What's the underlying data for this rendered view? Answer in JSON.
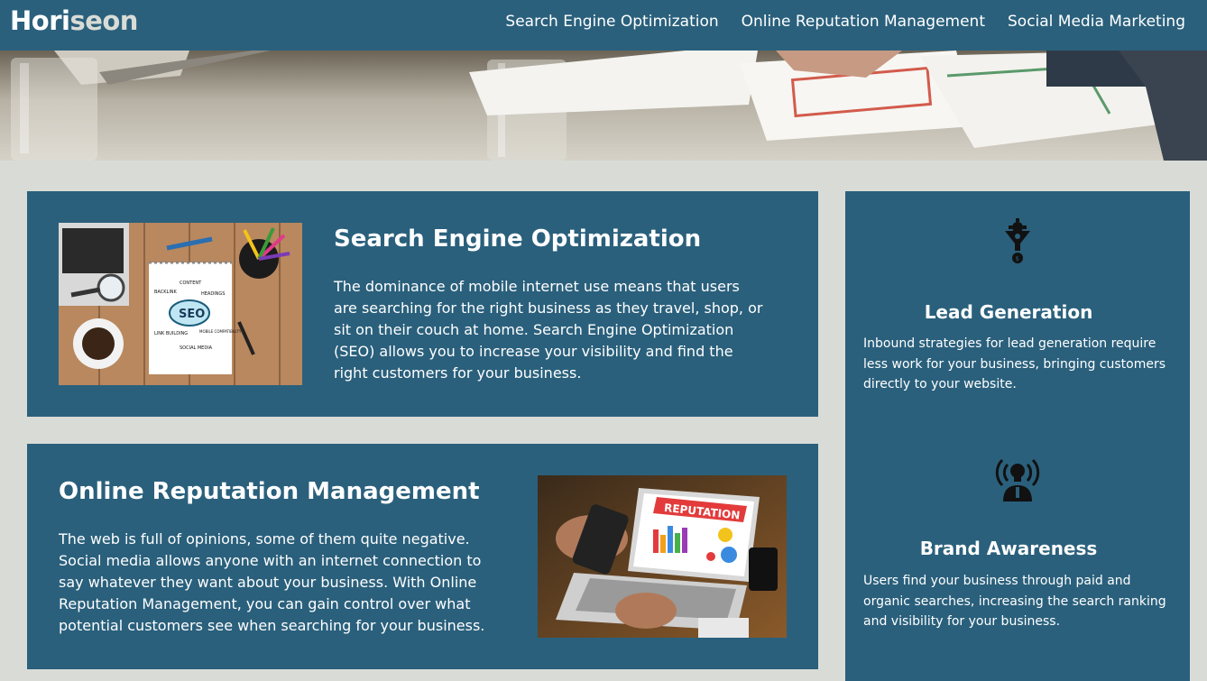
{
  "header": {
    "logo_part1": "Hori",
    "logo_part2": "seon",
    "nav": [
      {
        "label": "Search Engine Optimization"
      },
      {
        "label": "Online Reputation Management"
      },
      {
        "label": "Social Media Marketing"
      }
    ]
  },
  "main": {
    "seo": {
      "title": "Search Engine Optimization",
      "text": "The dominance of mobile internet use means that users are searching for the right business as they travel, shop, or sit on their couch at home. Search Engine Optimization (SEO) allows you to increase your visibility and find the right customers for your business.",
      "image_words": [
        "CONTENT",
        "BACKLINK",
        "HEADINGS",
        "SEO",
        "LINK BUILDING",
        "MOBILE COMPATIBILITY",
        "SOCIAL MEDIA"
      ]
    },
    "orm": {
      "title": "Online Reputation Management",
      "text": "The web is full of opinions, some of them quite negative. Social media allows anyone with an internet connection to say whatever they want about your business. With Online Reputation Management, you can gain control over what potential customers see when searching for your business.",
      "image_banner": "REPUTATION"
    }
  },
  "sidebar": {
    "lead": {
      "title": "Lead Generation",
      "text": "Inbound strategies for lead generation require less work for your business, bringing customers directly to your website."
    },
    "brand": {
      "title": "Brand Awareness",
      "text": "Users find your business through paid and organic searches, increasing the search ranking and visibility for your business."
    }
  },
  "colors": {
    "primary": "#2a607c",
    "background": "#d9dcd6",
    "text": "#ffffff"
  }
}
